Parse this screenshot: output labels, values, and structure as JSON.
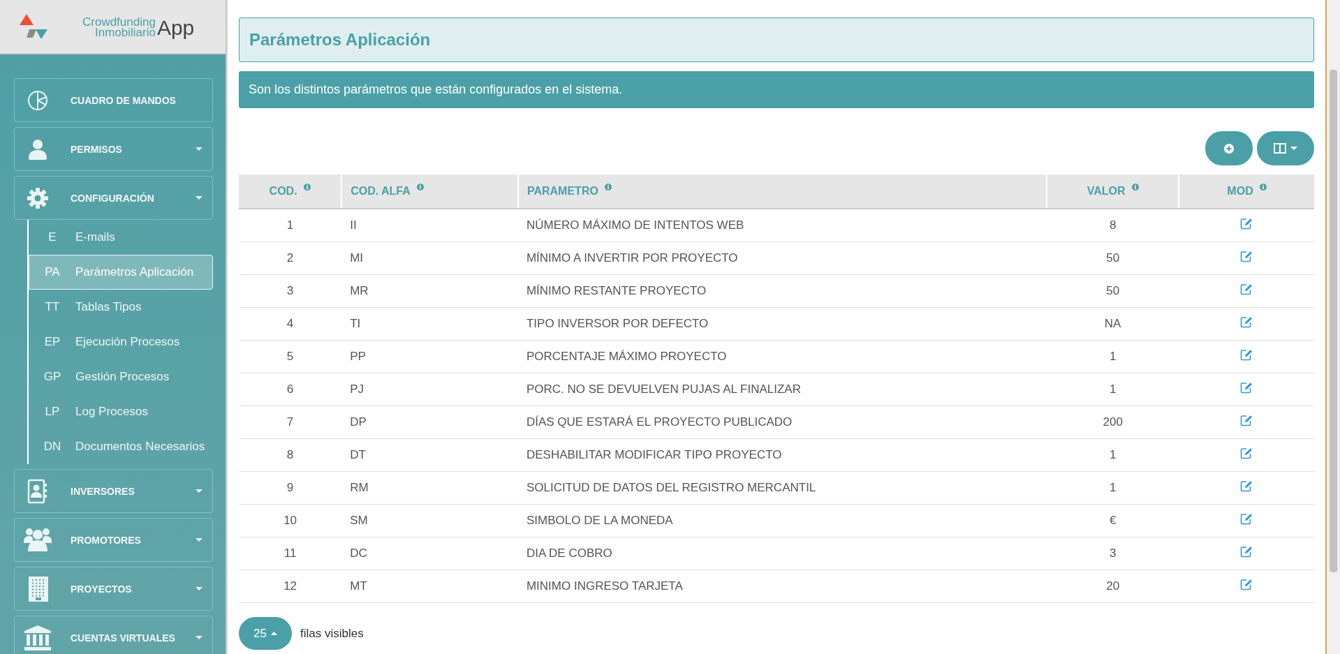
{
  "brand": {
    "line_1": "Crowdfunding",
    "line_2": "Inmobiliario",
    "app": "App"
  },
  "sidebar": {
    "items": [
      {
        "label": "CUADRO DE MANDOS",
        "expandable": false
      },
      {
        "label": "PERMISOS",
        "expandable": true
      },
      {
        "label": "CONFIGURACIÓN",
        "expandable": true,
        "children": [
          {
            "abbr": "E",
            "label": "E-mails",
            "selected": false
          },
          {
            "abbr": "PA",
            "label": "Parámetros Aplicación",
            "selected": true
          },
          {
            "abbr": "TT",
            "label": "Tablas Tipos",
            "selected": false
          },
          {
            "abbr": "EP",
            "label": "Ejecución Procesos",
            "selected": false
          },
          {
            "abbr": "GP",
            "label": "Gestión Procesos",
            "selected": false
          },
          {
            "abbr": "LP",
            "label": "Log Procesos",
            "selected": false
          },
          {
            "abbr": "DN",
            "label": "Documentos Necesarios",
            "selected": false
          }
        ]
      },
      {
        "label": "INVERSORES",
        "expandable": true
      },
      {
        "label": "PROMOTORES",
        "expandable": true
      },
      {
        "label": "PROYECTOS",
        "expandable": true
      },
      {
        "label": "CUENTAS VIRTUALES",
        "expandable": true
      }
    ]
  },
  "page": {
    "title": "Parámetros Aplicación",
    "description": "Son los distintos parámetros que están configurados en el sistema."
  },
  "table": {
    "columns": [
      "COD.",
      "COD. ALFA",
      "PARAMETRO",
      "VALOR",
      "MOD"
    ],
    "rows": [
      [
        "1",
        "II",
        "NÚMERO MÁXIMO DE INTENTOS WEB",
        "8"
      ],
      [
        "2",
        "MI",
        "MÍNIMO A INVERTIR POR PROYECTO",
        "50"
      ],
      [
        "3",
        "MR",
        "MÍNIMO RESTANTE PROYECTO",
        "50"
      ],
      [
        "4",
        "TI",
        "TIPO INVERSOR POR DEFECTO",
        "NA"
      ],
      [
        "5",
        "PP",
        "PORCENTAJE MÁXIMO PROYECTO",
        "1"
      ],
      [
        "6",
        "PJ",
        "PORC. NO SE DEVUELVEN PUJAS AL FINALIZAR",
        "1"
      ],
      [
        "7",
        "DP",
        "DÍAS QUE ESTARÁ EL PROYECTO PUBLICADO",
        "200"
      ],
      [
        "8",
        "DT",
        "DESHABILITAR MODIFICAR TIPO PROYECTO",
        "1"
      ],
      [
        "9",
        "RM",
        "SOLICITUD DE DATOS DEL REGISTRO MERCANTIL",
        "1"
      ],
      [
        "10",
        "SM",
        "SIMBOLO DE LA MONEDA",
        "€"
      ],
      [
        "11",
        "DC",
        "DIA DE COBRO",
        "3"
      ],
      [
        "12",
        "MT",
        "MINIMO INGRESO TARJETA",
        "20"
      ]
    ]
  },
  "pagination": {
    "page_size": "25",
    "label": "filas visibles"
  }
}
